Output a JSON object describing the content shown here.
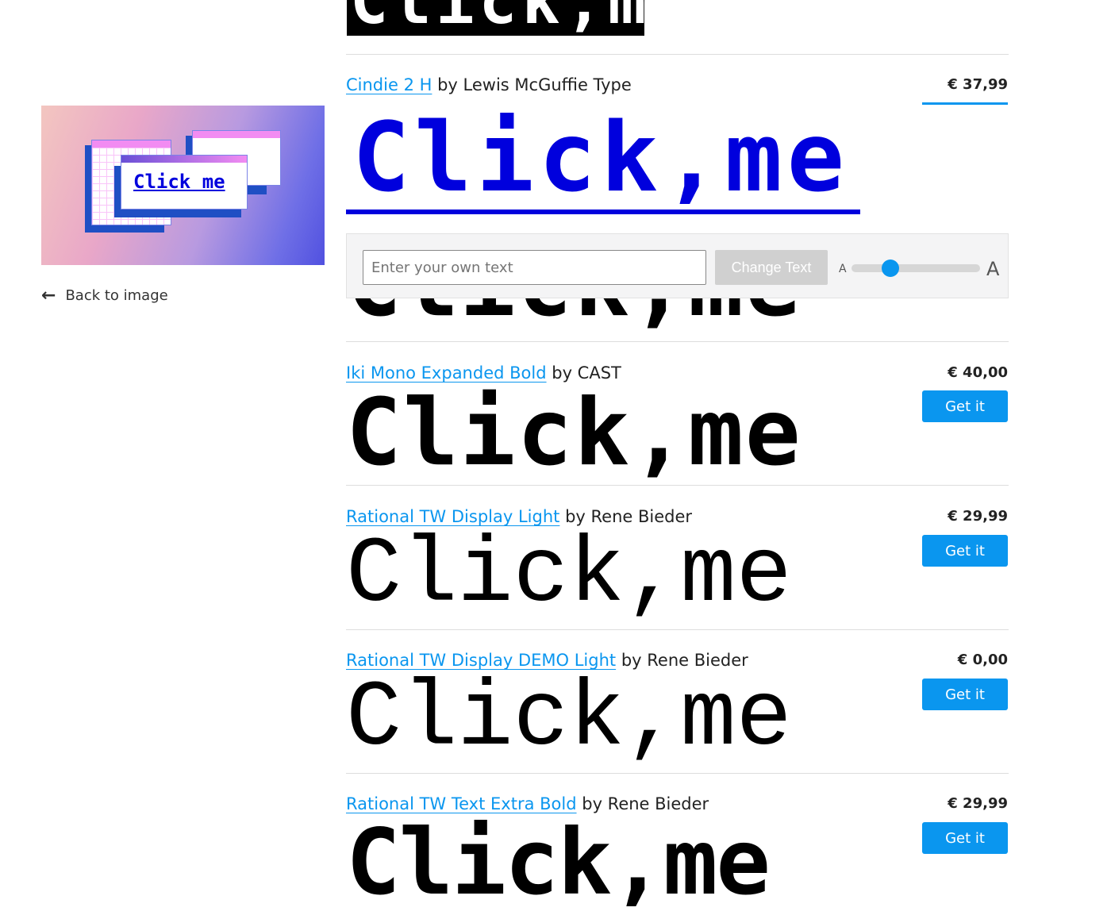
{
  "sample_text": "Click,me",
  "sidebar": {
    "hero_image_text": "Click me",
    "back_label": "Back to image"
  },
  "toolbar": {
    "input_placeholder": "Enter your own text",
    "input_value": "",
    "change_label": "Change Text",
    "size_small_label": "A",
    "size_large_label": "A",
    "size_level": 0.25
  },
  "accent": "#0a96ef",
  "fonts": [
    {
      "name": "Cindie 2 H",
      "by": "by Lewis McGuffie Type",
      "price": "€ 37,99",
      "color": "#0000dd"
    },
    {
      "name": "Iki Mono Expanded Bold",
      "by": "by CAST",
      "price": "€ 40,00",
      "button": "Get it"
    },
    {
      "name": "Rational TW Display Light",
      "by": "by Rene Bieder",
      "price": "€ 29,99",
      "button": "Get it"
    },
    {
      "name": "Rational TW Display DEMO Light",
      "by": "by Rene Bieder",
      "price": "€ 0,00",
      "button": "Get it"
    },
    {
      "name": "Rational TW Text Extra Bold",
      "by": "by Rene Bieder",
      "price": "€ 29,99",
      "button": "Get it"
    }
  ]
}
